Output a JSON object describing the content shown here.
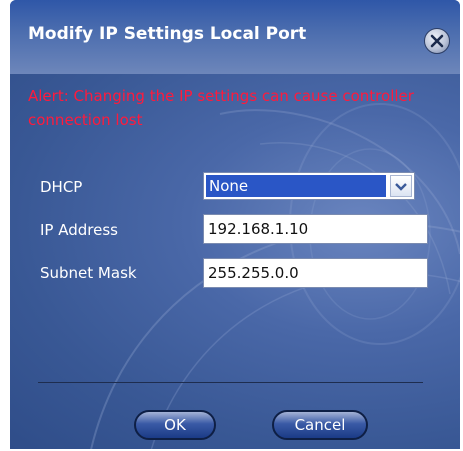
{
  "dialog": {
    "title": "Modify IP Settings Local Port",
    "alert": "Alert: Changing the IP settings can cause controller connection lost"
  },
  "fields": {
    "dhcp": {
      "label": "DHCP",
      "value": "None"
    },
    "ip_address": {
      "label": "IP Address",
      "value": "192.168.1.10"
    },
    "subnet_mask": {
      "label": "Subnet Mask",
      "value": "255.255.0.0"
    }
  },
  "buttons": {
    "ok": "OK",
    "cancel": "Cancel"
  },
  "icons": {
    "close": "close-icon",
    "dropdown": "chevron-down-icon"
  },
  "colors": {
    "title_bar": "#2f57a8",
    "body_bg": "#3c5ea2",
    "alert_text": "#ff1a3c",
    "selected_bg": "#2a56c6"
  }
}
